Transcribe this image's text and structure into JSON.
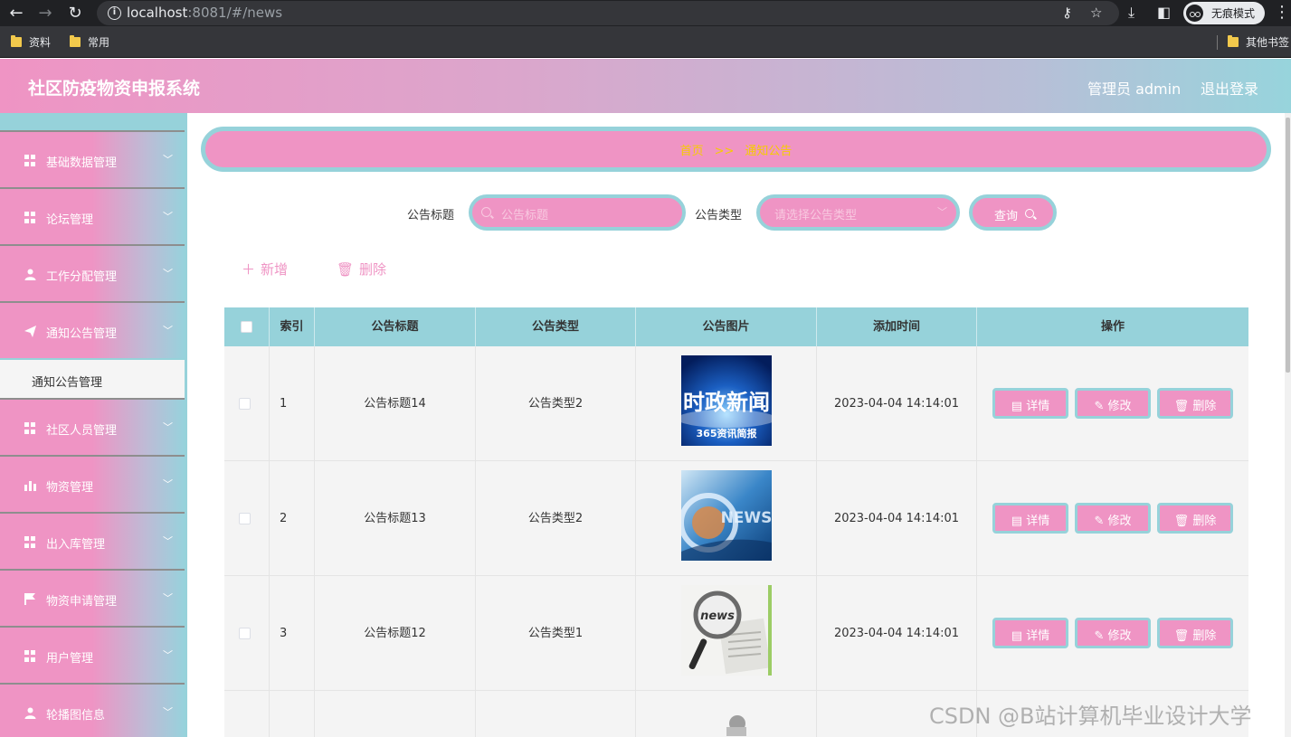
{
  "browser": {
    "url_host": "localhost",
    "url_rest": ":8081/#/news",
    "incognito_label": "无痕模式",
    "bookmarks": [
      "资料",
      "常用"
    ],
    "other_bookmarks": "其他书签"
  },
  "header": {
    "title": "社区防疫物资申报系统",
    "admin": "管理员 admin",
    "logout": "退出登录"
  },
  "sidebar": {
    "items": [
      {
        "label": "基础数据管理",
        "icon": "grid-icon"
      },
      {
        "label": "论坛管理",
        "icon": "grid-icon"
      },
      {
        "label": "工作分配管理",
        "icon": "user-icon"
      },
      {
        "label": "通知公告管理",
        "icon": "send-icon"
      },
      {
        "label": "社区人员管理",
        "icon": "grid-icon"
      },
      {
        "label": "物资管理",
        "icon": "bar-chart-icon"
      },
      {
        "label": "出入库管理",
        "icon": "grid-icon"
      },
      {
        "label": "物资申请管理",
        "icon": "flag-icon"
      },
      {
        "label": "用户管理",
        "icon": "grid-icon"
      },
      {
        "label": "轮播图信息",
        "icon": "user-icon"
      }
    ],
    "active_submenu": "通知公告管理"
  },
  "breadcrumb": {
    "home": "首页",
    "separator": ">>",
    "current": "通知公告"
  },
  "search": {
    "title_label": "公告标题",
    "title_placeholder": "公告标题",
    "type_label": "公告类型",
    "type_placeholder": "请选择公告类型",
    "query_label": "查询"
  },
  "actions": {
    "add_label": "新增",
    "delete_label": "删除"
  },
  "table": {
    "columns": [
      "索引",
      "公告标题",
      "公告类型",
      "公告图片",
      "添加时间",
      "操作"
    ],
    "rows": [
      {
        "index": "1",
        "title": "公告标题14",
        "type": "公告类型2",
        "time": "2023-04-04 14:14:01",
        "image_text": "时政新闻",
        "image_sub": "365资讯简报"
      },
      {
        "index": "2",
        "title": "公告标题13",
        "type": "公告类型2",
        "time": "2023-04-04 14:14:01",
        "image_text": "NEWS"
      },
      {
        "index": "3",
        "title": "公告标题12",
        "type": "公告类型1",
        "time": "2023-04-04 14:14:01",
        "image_text": "news"
      }
    ],
    "op_labels": {
      "detail": "详情",
      "edit": "修改",
      "delete": "删除"
    }
  },
  "watermark": "CSDN @B站计算机毕业设计大学",
  "colors": {
    "pink": "#ef94c4",
    "teal": "#96d2da",
    "crumb": "#f6cc00"
  }
}
